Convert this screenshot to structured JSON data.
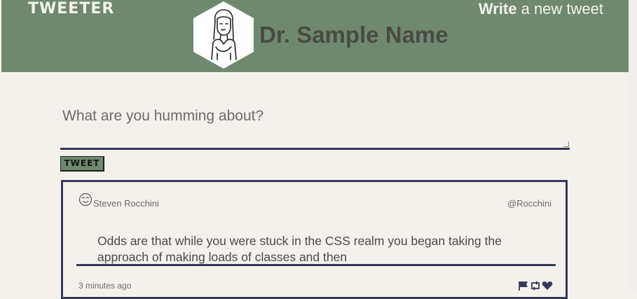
{
  "header": {
    "logo": "TWEETER",
    "write_bold": "Write",
    "write_rest": " a new tweet",
    "user_name": "Dr. Sample Name"
  },
  "compose": {
    "placeholder": "What are you humming about?",
    "button_label": "TWEET"
  },
  "tweet": {
    "author_name": "Steven Rocchini",
    "handle": "@Rocchini",
    "body": "Odds are that while you were stuck in the CSS realm you began taking the approach of making loads of classes and then",
    "timestamp": "3 minutes ago",
    "actions": [
      "flag-icon",
      "retweet-icon",
      "heart-icon"
    ]
  },
  "colors": {
    "header_bg": "#6f8971",
    "page_bg": "#f4f1ec",
    "accent_border": "#34385a"
  }
}
